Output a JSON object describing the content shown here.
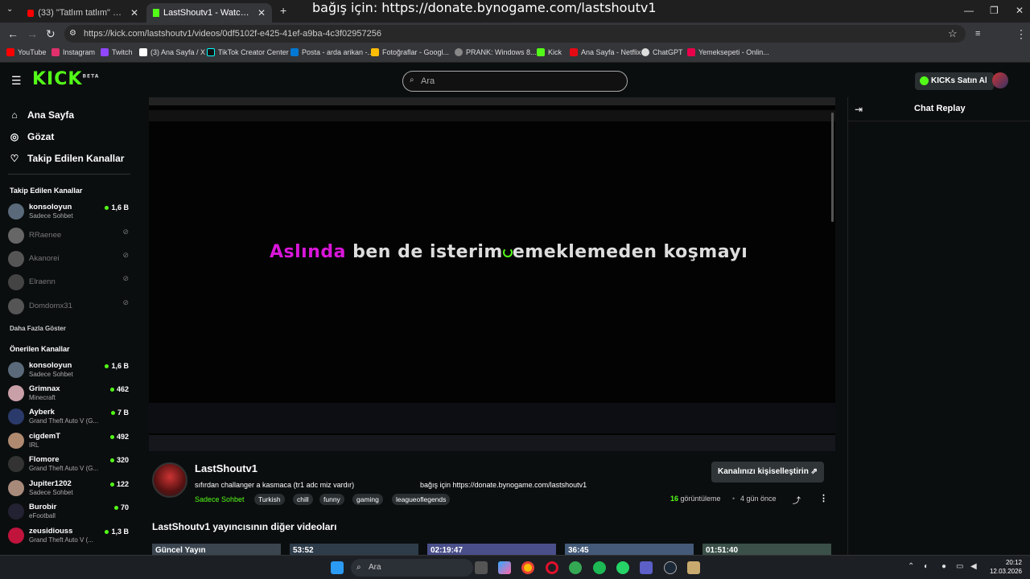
{
  "browser": {
    "tabs": [
      {
        "title": "(33) \"Tatlım tatlım\" cover by Bil...",
        "active": false
      },
      {
        "title": "LastShoutv1 - Watch the V...",
        "active": true
      }
    ],
    "new_tab": "+",
    "overlay_text": "bağış için: https://donate.bynogame.com/lastshoutv1",
    "url": "https://kick.com/lastshoutv1/videos/0df5102f-e425-41ef-a9ba-4c3f02957256",
    "bookmarks": [
      {
        "label": "YouTube",
        "color": "#ff0000"
      },
      {
        "label": "Instagram",
        "color": "#e1306c"
      },
      {
        "label": "Twitch",
        "color": "#9146ff"
      },
      {
        "label": "(3) Ana Sayfa / X",
        "color": "#ffffff"
      },
      {
        "label": "TikTok Creator Center",
        "color": "#111111"
      },
      {
        "label": "Posta - arda arikan -...",
        "color": "#0078d4"
      },
      {
        "label": "Fotoğraflar - Googl...",
        "color": "#fbbc05"
      },
      {
        "label": "PRANK: Windows 8...",
        "color": "#888888"
      },
      {
        "label": "Kick",
        "color": "#53fc18"
      },
      {
        "label": "Ana Sayfa - Netflix",
        "color": "#e50914"
      },
      {
        "label": "ChatGPT",
        "color": "#dddddd"
      },
      {
        "label": "Yemeksepeti - Onlin...",
        "color": "#ea004b"
      }
    ]
  },
  "header": {
    "logo": "KICK",
    "logo_badge": "BETA",
    "search_placeholder": "Ara",
    "buy_button": "KICKs Satın Al"
  },
  "sidebar": {
    "nav": [
      {
        "label": "Ana Sayfa",
        "icon": "home-icon"
      },
      {
        "label": "Gözat",
        "icon": "compass-icon"
      },
      {
        "label": "Takip Edilen Kanallar",
        "icon": "heart-icon"
      }
    ],
    "followed_title": "Takip Edilen Kanallar",
    "followed": [
      {
        "name": "konsoloyun",
        "category": "Sadece Sohbet",
        "viewers": "1,6 B",
        "live": true
      },
      {
        "name": "RRaenee",
        "live": false
      },
      {
        "name": "Akanorei",
        "live": false
      },
      {
        "name": "Elraenn",
        "live": false
      },
      {
        "name": "Domdomx31",
        "live": false
      }
    ],
    "show_more": "Daha Fazla Göster",
    "recommended_title": "Önerilen Kanallar",
    "recommended": [
      {
        "name": "konsoloyun",
        "category": "Sadece Sohbet",
        "viewers": "1,6 B"
      },
      {
        "name": "Grimnax",
        "category": "Minecraft",
        "viewers": "462"
      },
      {
        "name": "Ayberk",
        "category": "Grand Theft Auto V (G...",
        "viewers": "7 B"
      },
      {
        "name": "cigdemT",
        "category": "IRL",
        "viewers": "492"
      },
      {
        "name": "Flomore",
        "category": "Grand Theft Auto V (G...",
        "viewers": "320"
      },
      {
        "name": "Jupiter1202",
        "category": "Sadece Sohbet",
        "viewers": "122"
      },
      {
        "name": "Burobir",
        "category": "eFootball",
        "viewers": "70"
      },
      {
        "name": "zeusidiouss",
        "category": "Grand Theft Auto V (...",
        "viewers": "1,3 B"
      }
    ]
  },
  "video": {
    "lyric_highlight": "Aslında",
    "lyric_rest_1": " ben de isterim",
    "lyric_rest_2": "emeklemeden koşmayı"
  },
  "chat": {
    "title": "Chat Replay"
  },
  "info": {
    "channel_name": "LastShoutv1",
    "title": "sıfırdan challanger a kasmaca (tr1 adc miz vardır)",
    "donate_text": "bağış için https://donate.bynogame.com/lastshoutv1",
    "category": "Sadece Sohbet",
    "tags": [
      "Turkish",
      "chill",
      "funny",
      "gaming",
      "leagueoflegends"
    ],
    "customize_button": "Kanalınızı kişiselleştirin",
    "views_count": "16",
    "views_label": "görüntüleme",
    "age": "4 gün önce",
    "other_videos_title": "LastShoutv1 yayıncısının diğer videoları",
    "thumbnails": [
      "Güncel Yayın",
      "53:52",
      "02:19:47",
      "36:45",
      "01:51:40"
    ]
  },
  "taskbar": {
    "search": "Ara",
    "time": "20:12",
    "date": "12.03.2026"
  },
  "colors": {
    "accent": "#53fc18",
    "background": "#0b0e0f",
    "lyric_highlight": "#d916d9"
  }
}
